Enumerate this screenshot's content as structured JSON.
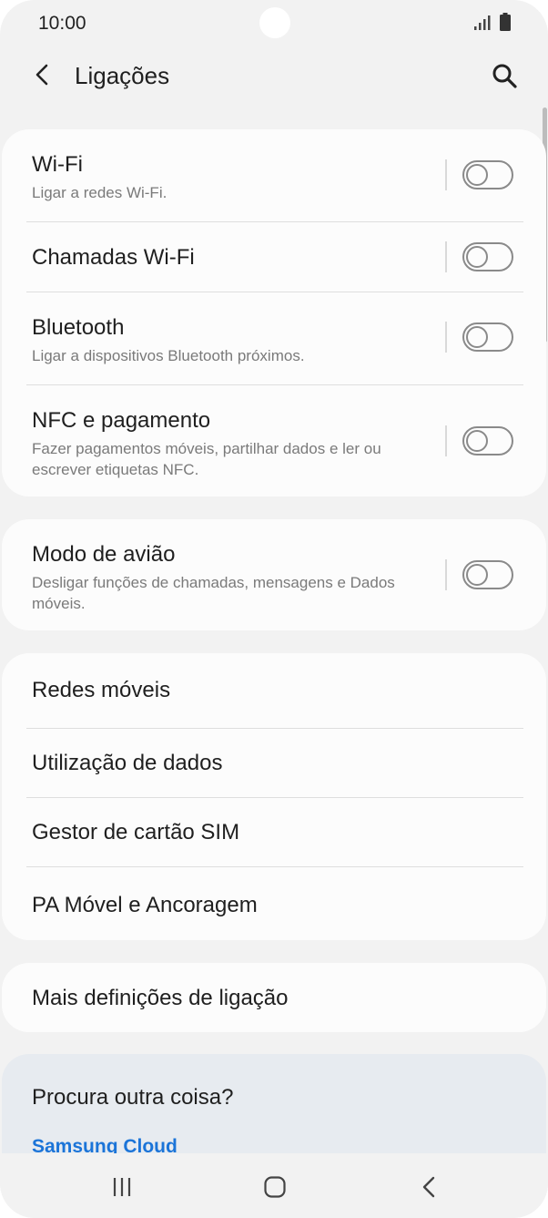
{
  "status_bar": {
    "time": "10:00"
  },
  "header": {
    "title": "Ligações",
    "icons": {
      "back": "back-arrow-icon",
      "search": "search-icon"
    }
  },
  "connections": [
    {
      "title": "Wi-Fi",
      "subtitle": "Ligar a redes Wi-Fi.",
      "enabled": false
    },
    {
      "title": "Chamadas Wi-Fi",
      "subtitle": "",
      "enabled": false
    },
    {
      "title": "Bluetooth",
      "subtitle": "Ligar a dispositivos Bluetooth próximos.",
      "enabled": false
    },
    {
      "title": "NFC e pagamento",
      "subtitle": "Fazer pagamentos móveis, partilhar dados e ler ou escrever etiquetas NFC.",
      "enabled": false
    }
  ],
  "airplane": {
    "title": "Modo de avião",
    "subtitle": "Desligar funções de chamadas, mensagens e Dados móveis.",
    "enabled": false
  },
  "network_items": [
    {
      "title": "Redes móveis"
    },
    {
      "title": "Utilização de dados"
    },
    {
      "title": "Gestor de cartão SIM"
    },
    {
      "title": "PA Móvel e Ancoragem"
    }
  ],
  "more_settings": {
    "title": "Mais definições de ligação"
  },
  "suggestions": {
    "title": "Procura outra coisa?",
    "link": "Samsung Cloud"
  },
  "colors": {
    "background": "#f2f2f2",
    "card": "#fcfcfc",
    "suggestion_card": "#e7ebf0",
    "link": "#1b74d8",
    "toggle_off": "#8a8a8a"
  }
}
